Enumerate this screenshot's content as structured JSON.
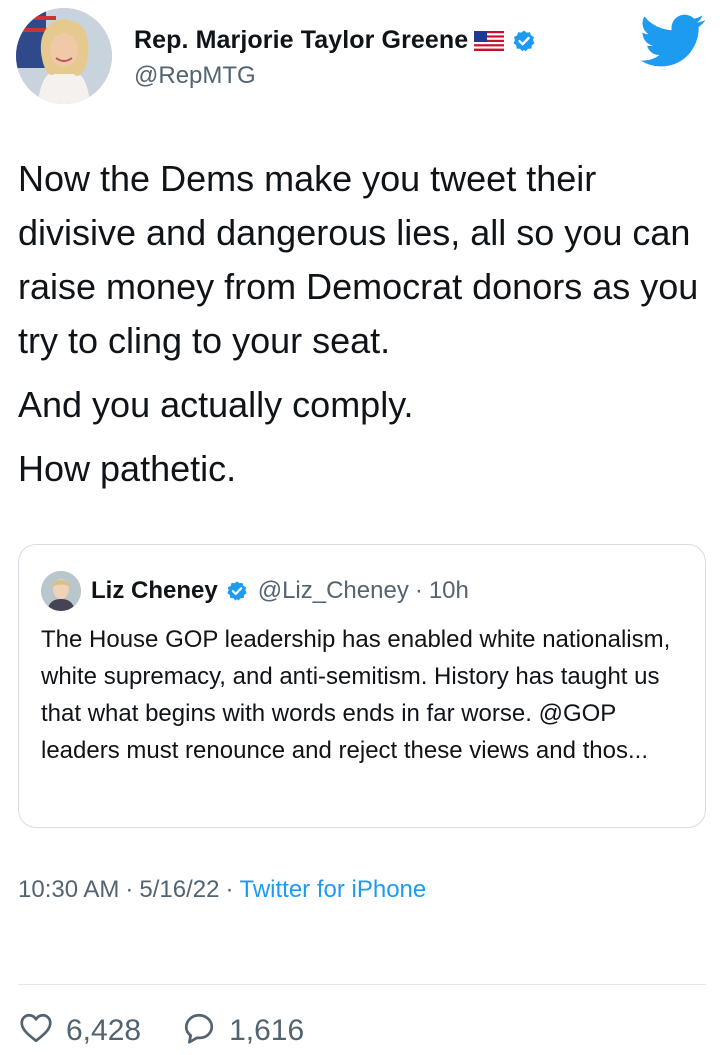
{
  "author": {
    "name": "Rep. Marjorie Taylor Greene",
    "handle": "@RepMTG",
    "flag_icon": "us-flag-icon",
    "verified_icon": "verified-badge-icon"
  },
  "brand": {
    "logo_icon": "twitter-bird-icon",
    "color": "#1d9bf0"
  },
  "tweet": {
    "paragraphs": [
      "Now the Dems make you tweet their divisive and dangerous lies, all so you can raise money from Democrat donors as you try to cling to your seat.",
      "And you actually comply.",
      "How pathetic."
    ]
  },
  "quote": {
    "name": "Liz Cheney",
    "handle": "@Liz_Cheney",
    "separator": "·",
    "time": "10h",
    "text": "The House GOP leadership has enabled white nationalism, white supremacy, and anti-semitism. History has taught us that what begins with words ends in far worse. @GOP leaders must renounce and reject these views and thos..."
  },
  "meta": {
    "time": "10:30 AM",
    "sep1": "·",
    "date": "5/16/22",
    "sep2": "·",
    "source": "Twitter for iPhone"
  },
  "stats": {
    "likes": "6,428",
    "replies": "1,616",
    "like_icon": "heart-icon",
    "reply_icon": "reply-bubble-icon"
  }
}
